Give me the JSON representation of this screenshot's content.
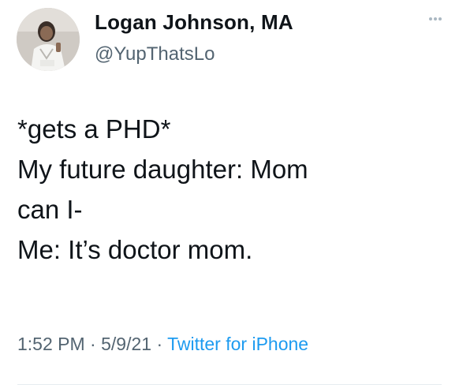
{
  "author": {
    "display_name": "Logan Johnson, MA",
    "handle": "@YupThatsLo",
    "avatar_icon": "profile-photo"
  },
  "header": {
    "more_icon": "more-horizontal-icon"
  },
  "tweet": {
    "lines": [
      "*gets a PHD*",
      "My future daughter: Mom",
      "can I-",
      "Me: It’s doctor mom."
    ]
  },
  "meta": {
    "time": "1:52 PM",
    "separator": "·",
    "date": "5/9/21",
    "source": "Twitter for iPhone"
  },
  "colors": {
    "text": "#0f1419",
    "secondary": "#536471",
    "link": "#1d9bf0"
  }
}
